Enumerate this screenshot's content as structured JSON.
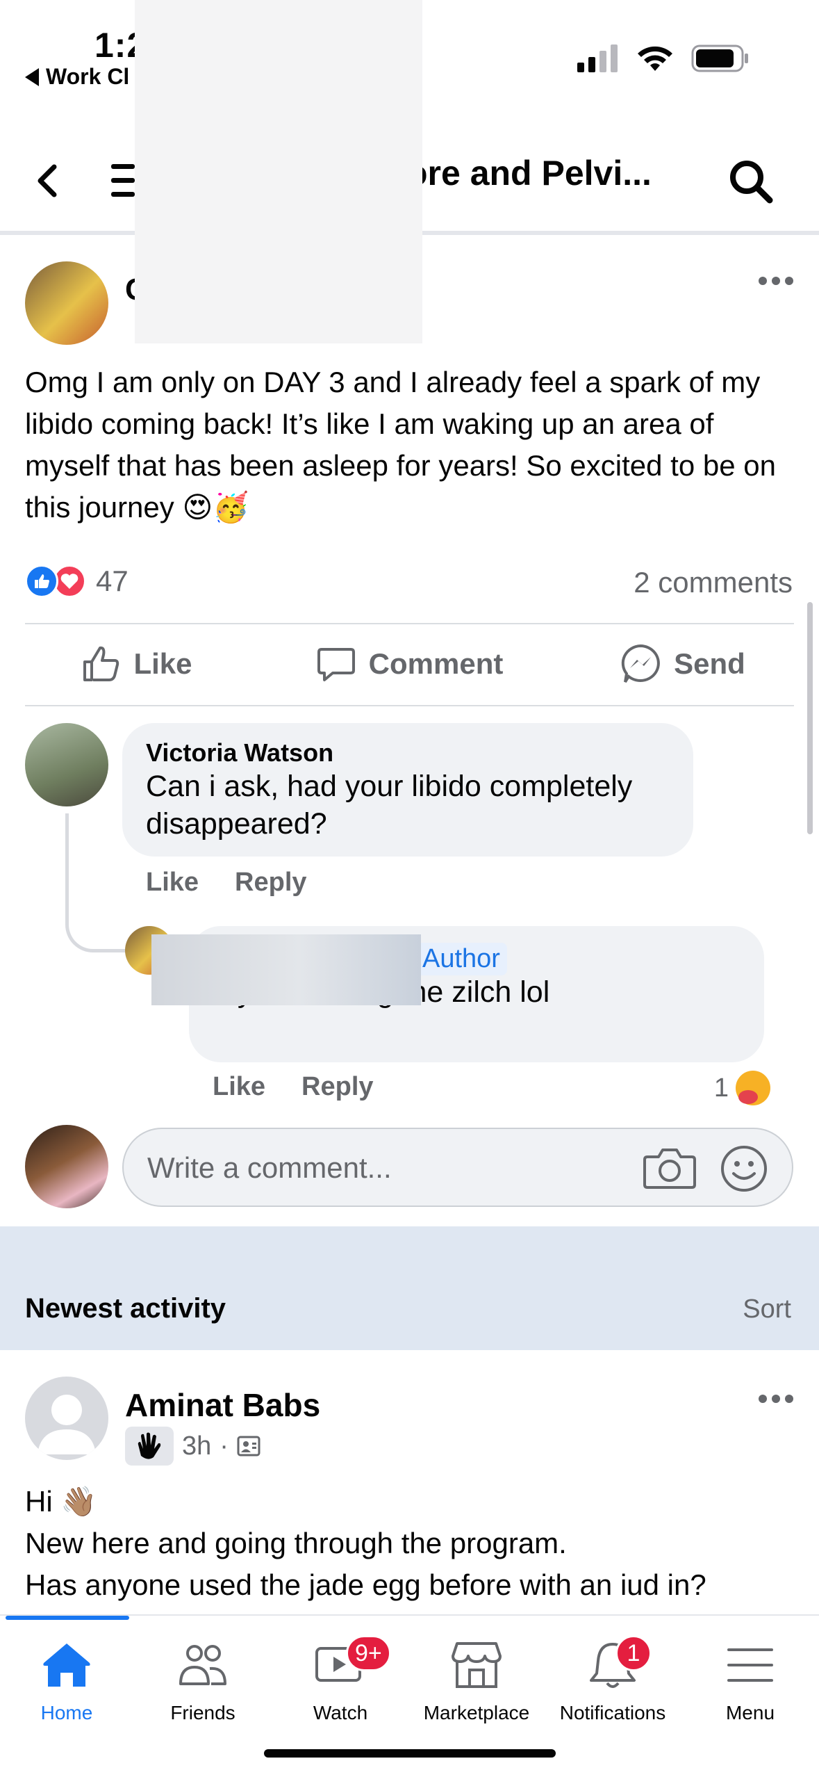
{
  "status_bar": {
    "time": "1:2",
    "back_app": "Work Cl"
  },
  "header": {
    "title": "ore and Pelvi..."
  },
  "post": {
    "author_partial": "C",
    "text": "Omg I am only on DAY 3 and I already feel a spark of my libido coming back! It’s like I am waking up an area of myself that has been asleep for years! So excited to be on this journey 😍🥳",
    "reaction_count": "47",
    "comments_count": "2 comments",
    "actions": {
      "like": "Like",
      "comment": "Comment",
      "send": "Send"
    }
  },
  "comments": [
    {
      "name": "Victoria Watson",
      "text": "Can i ask, had your libido completely disappeared?",
      "like": "Like",
      "reply": "Reply"
    },
    {
      "badge": "Author",
      "tagged_partial": "n",
      "text": " yes 100% gone zilch lol",
      "like": "Like",
      "reply": "Reply",
      "reaction_count": "1"
    }
  ],
  "composer": {
    "placeholder": "Write a comment..."
  },
  "section": {
    "title": "Newest activity",
    "sort": "Sort"
  },
  "post2": {
    "author": "Aminat Babs",
    "time": "3h",
    "line1": "Hi 👋🏽",
    "line2": "New here and going through the program.",
    "line3": "Has anyone used the jade egg before with an iud in?"
  },
  "tabs": [
    {
      "label": "Home",
      "icon": "home-icon",
      "active": true
    },
    {
      "label": "Friends",
      "icon": "friends-icon"
    },
    {
      "label": "Watch",
      "icon": "watch-icon",
      "badge": "9+"
    },
    {
      "label": "Marketplace",
      "icon": "marketplace-icon"
    },
    {
      "label": "Notifications",
      "icon": "bell-icon",
      "badge": "1"
    },
    {
      "label": "Menu",
      "icon": "menu-icon"
    }
  ],
  "colors": {
    "accent": "#1877f2",
    "badge": "#e41e3f",
    "love": "#f33e58"
  }
}
